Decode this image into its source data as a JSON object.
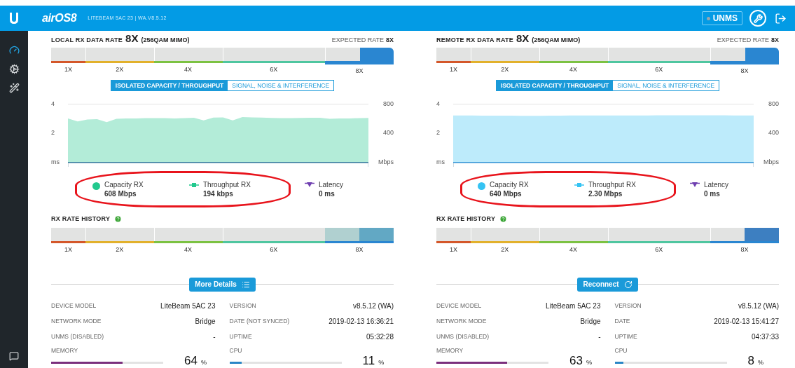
{
  "header": {
    "logo_text": "airOS8",
    "subtitle": "LITEBEAM 5AC 23 | WA.V8.5.12",
    "unms": {
      "label": "UNMS",
      "connected": false
    }
  },
  "sidebar": {
    "items": [
      {
        "selected": true
      },
      {
        "selected": false
      },
      {
        "selected": false
      }
    ]
  },
  "panels": [
    {
      "title": "LOCAL RX DATA RATE",
      "rate": "8X",
      "modulation": "(256QAM MIMO)",
      "expected_label": "EXPECTED RATE",
      "expected_value": "8X",
      "rate_scale": [
        {
          "label": "1X",
          "color": "#d4572a",
          "selected": false
        },
        {
          "label": "2X",
          "color": "#e2b12c",
          "selected": false
        },
        {
          "label": "4X",
          "color": "#7cc242",
          "selected": false
        },
        {
          "label": "6X",
          "color": "#4fc6a0",
          "selected": false
        },
        {
          "label": "8X",
          "color": "#2a86d1",
          "selected": true
        }
      ],
      "view_tabs": [
        {
          "label": "ISOLATED CAPACITY / THROUGHPUT",
          "selected": true
        },
        {
          "label": "SIGNAL, NOISE & INTERFERENCE",
          "selected": false
        }
      ],
      "chart": {
        "left_ticks": [
          "4",
          "2"
        ],
        "left_unit": "ms",
        "right_ticks": [
          "800",
          "400"
        ],
        "right_unit": "Mbps"
      },
      "legend_circled": [
        {
          "kind": "dot",
          "color": "#22c98e",
          "label": "Capacity RX",
          "value": "608 Mbps"
        },
        {
          "kind": "square",
          "color": "#22c98e",
          "label": "Throughput RX",
          "value": "194 kbps"
        }
      ],
      "legend": [
        {
          "kind": "triangle",
          "color": "#6f3fb0",
          "label": "Latency",
          "value": "0 ms"
        }
      ],
      "history": {
        "title": "RX RATE HISTORY",
        "scale": [
          {
            "label": "1X",
            "color": "#d4572a"
          },
          {
            "label": "2X",
            "color": "#e2b12c"
          },
          {
            "label": "4X",
            "color": "#7cc242"
          },
          {
            "label": "6X",
            "color": "#4fc6a0"
          },
          {
            "label": "8X",
            "color": "#2a86d1"
          }
        ],
        "blocks": [
          {
            "color": "#b0d0d0"
          },
          {
            "color": "#62a8c4"
          }
        ]
      },
      "action": {
        "label": "More Details",
        "kind": "details"
      },
      "columns": [
        {
          "rows": [
            {
              "label": "DEVICE MODEL",
              "value": "LiteBeam 5AC 23"
            },
            {
              "label": "NETWORK MODE",
              "value": "Bridge"
            },
            {
              "label": "UNMS (DISABLED)",
              "value": "-"
            }
          ],
          "meter": {
            "label": "MEMORY",
            "level": 0.64,
            "reading": "64",
            "unit": "%",
            "color": "#7b2f7d"
          }
        },
        {
          "rows": [
            {
              "label": "VERSION",
              "value": "v8.5.12 (WA)"
            },
            {
              "label": "DATE (NOT SYNCED)",
              "value": "2019-02-13 16:36:21"
            },
            {
              "label": "UPTIME",
              "value": "05:32:28"
            }
          ],
          "meter": {
            "label": "CPU",
            "level": 0.11,
            "reading": "11",
            "unit": "%",
            "color": "#2a86c6"
          }
        }
      ]
    },
    {
      "title": "REMOTE RX DATA RATE",
      "rate": "8X",
      "modulation": "(256QAM MIMO)",
      "expected_label": "EXPECTED RATE",
      "expected_value": "8X",
      "rate_scale": [
        {
          "label": "1X",
          "color": "#d4572a",
          "selected": false
        },
        {
          "label": "2X",
          "color": "#e2b12c",
          "selected": false
        },
        {
          "label": "4X",
          "color": "#7cc242",
          "selected": false
        },
        {
          "label": "6X",
          "color": "#4fc6a0",
          "selected": false
        },
        {
          "label": "8X",
          "color": "#2a86d1",
          "selected": true
        }
      ],
      "view_tabs": [
        {
          "label": "ISOLATED CAPACITY / THROUGHPUT",
          "selected": true
        },
        {
          "label": "SIGNAL, NOISE & INTERFERENCE",
          "selected": false
        }
      ],
      "chart": {
        "left_ticks": [
          "4",
          "2"
        ],
        "left_unit": "ms",
        "right_ticks": [
          "800",
          "400"
        ],
        "right_unit": "Mbps"
      },
      "legend_circled": [
        {
          "kind": "dot",
          "color": "#35c3f3",
          "label": "Capacity RX",
          "value": "640 Mbps"
        },
        {
          "kind": "square",
          "color": "#35c3f3",
          "label": "Throughput RX",
          "value": "2.30 Mbps"
        }
      ],
      "legend": [
        {
          "kind": "triangle",
          "color": "#6f3fb0",
          "label": "Latency",
          "value": "0 ms"
        }
      ],
      "history": {
        "title": "RX RATE HISTORY",
        "scale": [
          {
            "label": "1X",
            "color": "#d4572a"
          },
          {
            "label": "2X",
            "color": "#e2b12c"
          },
          {
            "label": "4X",
            "color": "#7cc242"
          },
          {
            "label": "6X",
            "color": "#4fc6a0"
          },
          {
            "label": "8X",
            "color": "#2a86d1"
          }
        ],
        "blocks": [
          {
            "color": "#3d7fc1"
          }
        ]
      },
      "action": {
        "label": "Reconnect",
        "kind": "reconnect"
      },
      "columns": [
        {
          "rows": [
            {
              "label": "DEVICE MODEL",
              "value": "LiteBeam 5AC 23"
            },
            {
              "label": "NETWORK MODE",
              "value": "Bridge"
            },
            {
              "label": "UNMS (DISABLED)",
              "value": "-"
            }
          ],
          "meter": {
            "label": "MEMORY",
            "level": 0.63,
            "reading": "63",
            "unit": "%",
            "color": "#7b2f7d"
          }
        },
        {
          "rows": [
            {
              "label": "VERSION",
              "value": "v8.5.12 (WA)"
            },
            {
              "label": "DATE",
              "value": "2019-02-13 15:41:27"
            },
            {
              "label": "UPTIME",
              "value": "04:37:33"
            }
          ],
          "meter": {
            "label": "CPU",
            "level": 0.08,
            "reading": "8",
            "unit": "%",
            "color": "#2a86c6"
          }
        }
      ]
    }
  ]
}
